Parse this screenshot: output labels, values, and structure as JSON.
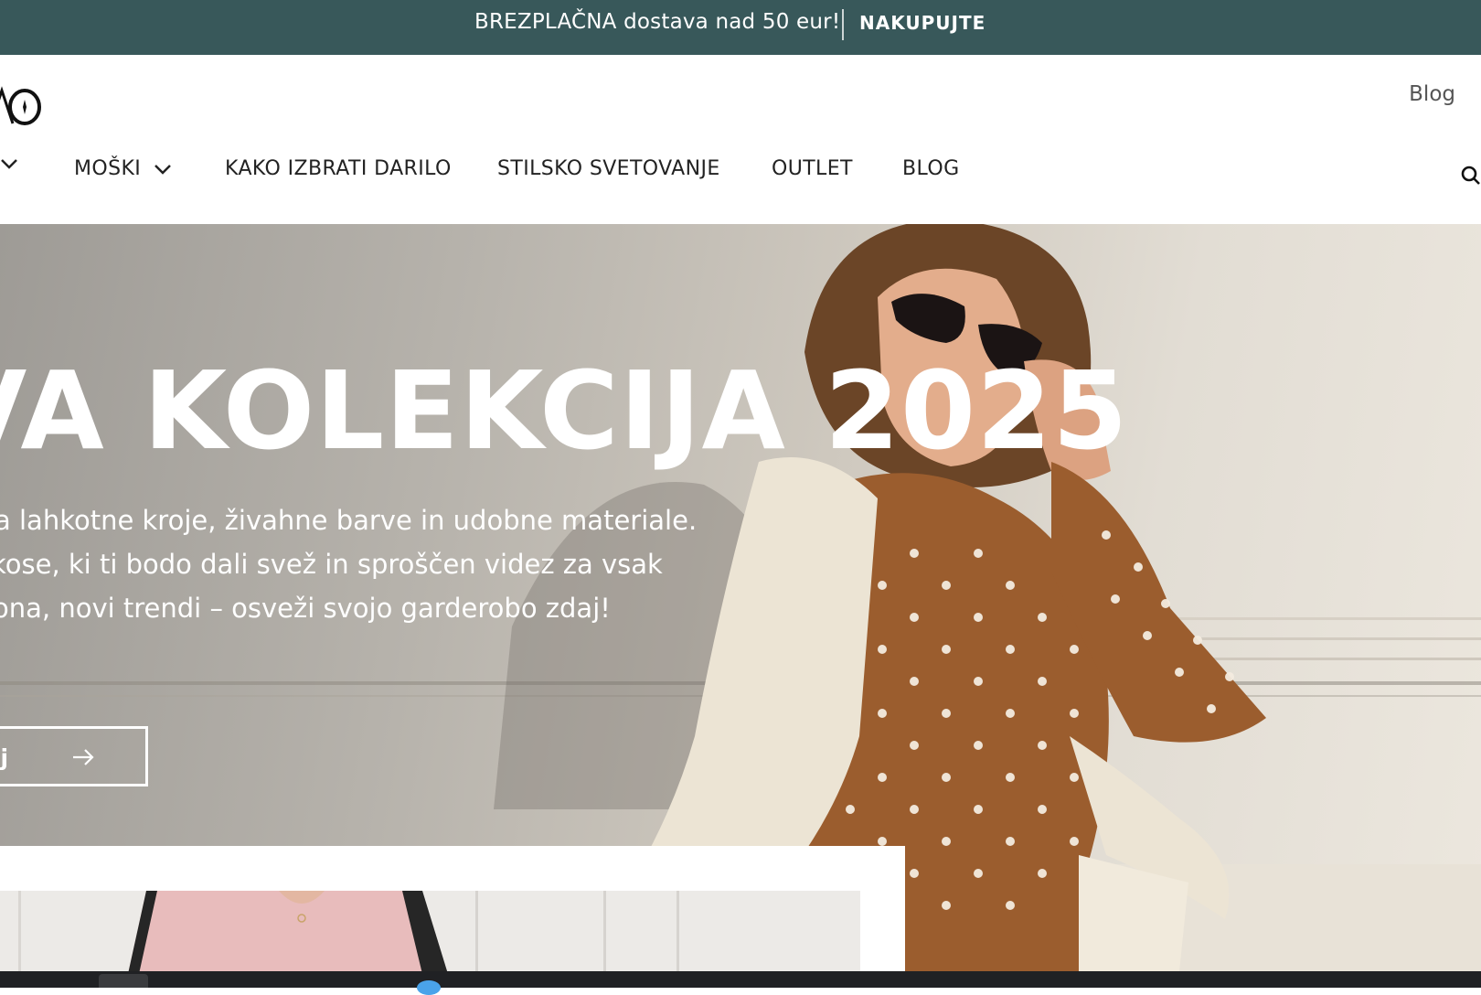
{
  "announcement": {
    "text": "BREZPLAČNA dostava nad 50 eur!",
    "cta": "NAKUPUJTE"
  },
  "header": {
    "utility_link": "Blog",
    "nav": [
      {
        "label": "MOŠKI",
        "has_dropdown": true
      },
      {
        "label": "KAKO IZBRATI DARILO",
        "has_dropdown": false
      },
      {
        "label": "STILSKO SVETOVANJE",
        "has_dropdown": false
      },
      {
        "label": "OUTLET",
        "has_dropdown": false
      },
      {
        "label": "BLOG",
        "has_dropdown": false
      }
    ],
    "search_icon": "search-icon"
  },
  "hero": {
    "title": "VA KOLEKCIJA 2025",
    "description": [
      "a lahkotne kroje, živahne barve in udobne materiale.",
      "kose, ki ti bodo dali svež in sproščen videz za vsak",
      "ona, novi trendi – osveži svojo garderobo zdaj!"
    ],
    "button_label": "laj",
    "button_icon": "arrow-right-icon"
  },
  "colors": {
    "announcement_bg": "#38585a",
    "text_dark": "#222222",
    "white": "#ffffff"
  }
}
